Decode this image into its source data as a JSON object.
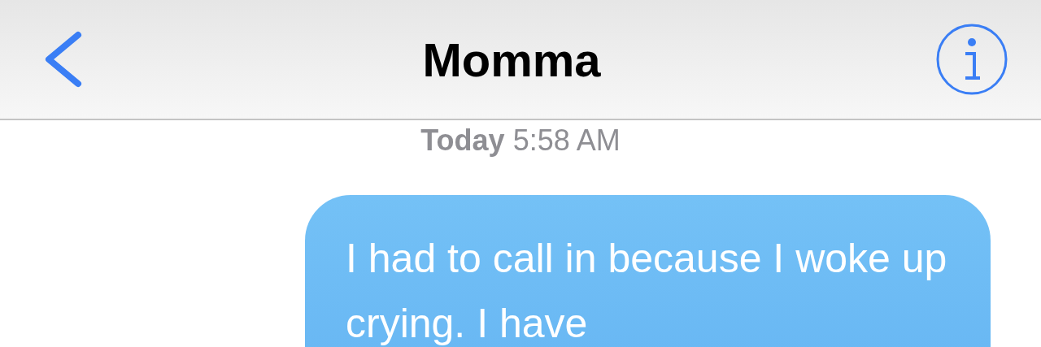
{
  "header": {
    "title": "Momma"
  },
  "timestamp": "**Today** 5:58 AM",
  "messages": [
    {
      "kind": "sent",
      "text": "I had to call in because I woke up crying. I have"
    }
  ]
}
